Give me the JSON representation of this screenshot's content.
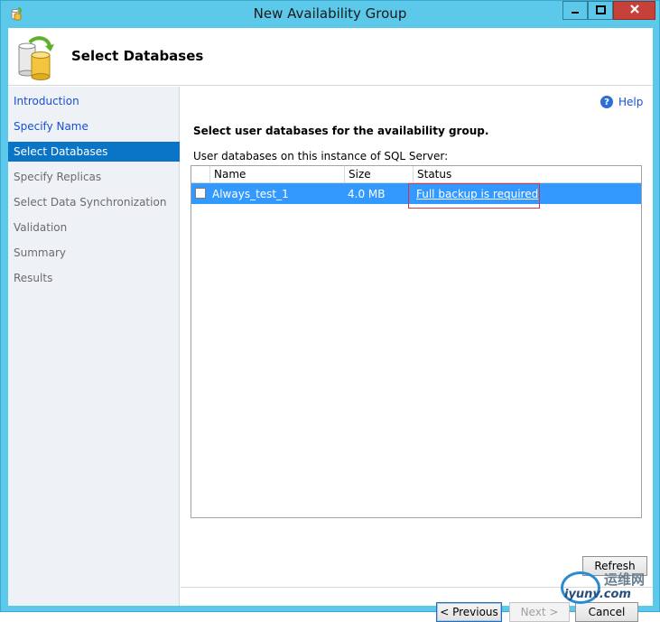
{
  "window": {
    "title": "New Availability Group"
  },
  "header": {
    "title": "Select Databases"
  },
  "nav": {
    "items": [
      {
        "label": "Introduction",
        "state": "link"
      },
      {
        "label": "Specify Name",
        "state": "link"
      },
      {
        "label": "Select Databases",
        "state": "selected"
      },
      {
        "label": "Specify Replicas",
        "state": "disabled"
      },
      {
        "label": "Select Data Synchronization",
        "state": "disabled"
      },
      {
        "label": "Validation",
        "state": "disabled"
      },
      {
        "label": "Summary",
        "state": "disabled"
      },
      {
        "label": "Results",
        "state": "disabled"
      }
    ]
  },
  "content": {
    "help_label": "Help",
    "instructions": "Select user databases for the availability group.",
    "grid_label": "User databases on this instance of SQL Server:",
    "columns": {
      "name": "Name",
      "size": "Size",
      "status": "Status"
    },
    "rows": [
      {
        "checked": false,
        "name": "Always_test_1",
        "size": "4.0 MB",
        "status": "Full backup is required"
      }
    ]
  },
  "buttons": {
    "refresh": "Refresh",
    "previous": "< Previous",
    "next": "Next >",
    "cancel": "Cancel"
  },
  "watermark": {
    "cn": "运维网",
    "url": "iyunv.com"
  },
  "colors": {
    "titlebar": "#5cc9ea",
    "selection": "#0a75c6",
    "row_highlight": "#3399ff",
    "link": "#1a4fd1",
    "annotation": "#e0323b"
  }
}
